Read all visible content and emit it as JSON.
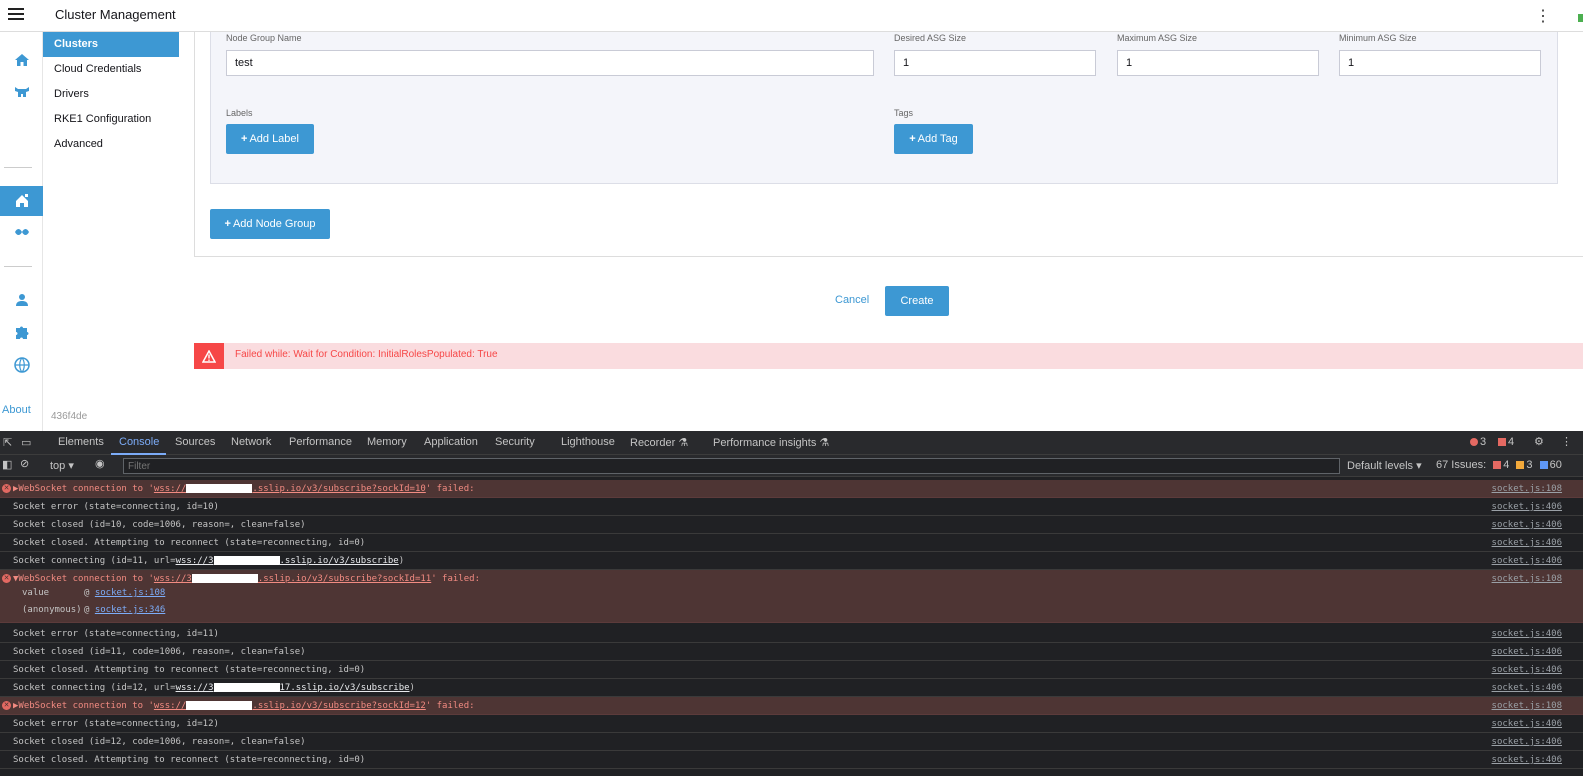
{
  "header": {
    "title": "Cluster Management"
  },
  "sidebar": {
    "items": [
      {
        "label": "Clusters",
        "active": true
      },
      {
        "label": "Cloud Credentials"
      },
      {
        "label": "Drivers"
      },
      {
        "label": "RKE1 Configuration"
      },
      {
        "label": "Advanced"
      }
    ],
    "about": "About",
    "version": "436f4de"
  },
  "rail": [
    "home-icon",
    "cow-icon",
    "cluster-management-icon",
    "fleet-icon",
    "user-icon",
    "extension-icon",
    "globe-icon"
  ],
  "form": {
    "node_group_name_label": "Node Group Name",
    "node_group_name_value": "test",
    "desired_label": "Desired ASG Size",
    "desired_value": "1",
    "maximum_label": "Maximum ASG Size",
    "maximum_value": "1",
    "minimum_label": "Minimum ASG Size",
    "minimum_value": "1",
    "labels_label": "Labels",
    "add_label_button": "Add Label",
    "tags_label": "Tags",
    "add_tag_button": "Add Tag",
    "add_node_group_button": "Add Node Group",
    "cancel": "Cancel",
    "create": "Create"
  },
  "error": {
    "message": "Failed while: Wait for Condition: InitialRolesPopulated: True"
  },
  "devtools": {
    "tabs": [
      "Elements",
      "Console",
      "Sources",
      "Network",
      "Performance",
      "Memory",
      "Application",
      "Security",
      "Lighthouse",
      "Recorder",
      "Performance insights"
    ],
    "active_tab": "Console",
    "errors_count": "3",
    "warnings_count": "4",
    "context": "top",
    "filter_placeholder": "Filter",
    "levels": "Default levels",
    "issues_label": "67 Issues:",
    "issues_errors": "4",
    "issues_warnings": "3",
    "issues_info": "60",
    "colors": {
      "accent": "#3d98d3",
      "error": "#f64747",
      "console_bg": "#202124"
    },
    "logs": [
      {
        "type": "error",
        "pre": "WebSocket connection to '",
        "url_a": "wss://",
        "url_b": ".sslip.io/v3/subscribe?sockId=10",
        "post": "' failed:",
        "src": "socket.js:108"
      },
      {
        "type": "log",
        "text": "Socket error (state=connecting, id=10)",
        "src": "socket.js:406"
      },
      {
        "type": "log",
        "text": "Socket closed (id=10, code=1006, reason=, clean=false)",
        "src": "socket.js:406"
      },
      {
        "type": "log",
        "text": "Socket closed. Attempting to reconnect (state=reconnecting, id=0)",
        "src": "socket.js:406"
      },
      {
        "type": "log",
        "pre": "Socket connecting (id=11, url=",
        "url_a": "wss://3",
        "url_b": ".sslip.io/v3/subscribe",
        "post": ")",
        "src": "socket.js:406"
      },
      {
        "type": "error",
        "pre": "WebSocket connection to '",
        "url_a": "wss://3",
        "url_b": ".sslip.io/v3/subscribe?sockId=11",
        "post": "' failed:",
        "src": "socket.js:108",
        "trace": [
          {
            "fn": "value",
            "at": "socket.js:108"
          },
          {
            "fn": "(anonymous)",
            "at": "socket.js:346"
          }
        ]
      },
      {
        "type": "log",
        "text": "Socket error (state=connecting, id=11)",
        "src": "socket.js:406"
      },
      {
        "type": "log",
        "text": "Socket closed (id=11, code=1006, reason=, clean=false)",
        "src": "socket.js:406"
      },
      {
        "type": "log",
        "text": "Socket closed. Attempting to reconnect (state=reconnecting, id=0)",
        "src": "socket.js:406"
      },
      {
        "type": "log",
        "pre": "Socket connecting (id=12, url=",
        "url_a": "wss://3",
        "url_b": "17.sslip.io/v3/subscribe",
        "post": ")",
        "src": "socket.js:406"
      },
      {
        "type": "error",
        "pre": "WebSocket connection to '",
        "url_a": "wss://",
        "url_b": ".sslip.io/v3/subscribe?sockId=12",
        "post": "' failed:",
        "src": "socket.js:108"
      },
      {
        "type": "log",
        "text": "Socket error (state=connecting, id=12)",
        "src": "socket.js:406"
      },
      {
        "type": "log",
        "text": "Socket closed (id=12, code=1006, reason=, clean=false)",
        "src": "socket.js:406"
      },
      {
        "type": "log",
        "text": "Socket closed. Attempting to reconnect (state=reconnecting, id=0)",
        "src": "socket.js:406"
      }
    ]
  }
}
